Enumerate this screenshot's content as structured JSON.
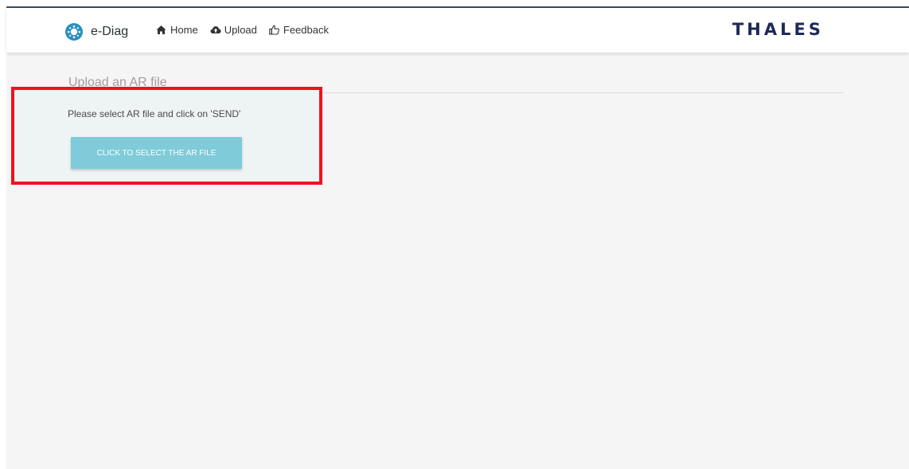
{
  "header": {
    "brand_name": "e-Diag",
    "logo_icon": "sun-gear-icon",
    "nav": [
      {
        "label": "Home",
        "icon": "home-icon"
      },
      {
        "label": "Upload",
        "icon": "cloud-upload-icon"
      },
      {
        "label": "Feedback",
        "icon": "thumbs-up-icon"
      }
    ],
    "company_logo": "THALES"
  },
  "main": {
    "title": "Upload an AR file",
    "instruction": "Please select AR file and click on 'SEND'",
    "select_button_label": "CLICK TO SELECT THE AR FILE"
  },
  "colors": {
    "accent": "#7fcbd9",
    "logo_blue": "#2a8fc0",
    "highlight_border": "#f2101c",
    "brand_navy": "#1e2a55"
  }
}
